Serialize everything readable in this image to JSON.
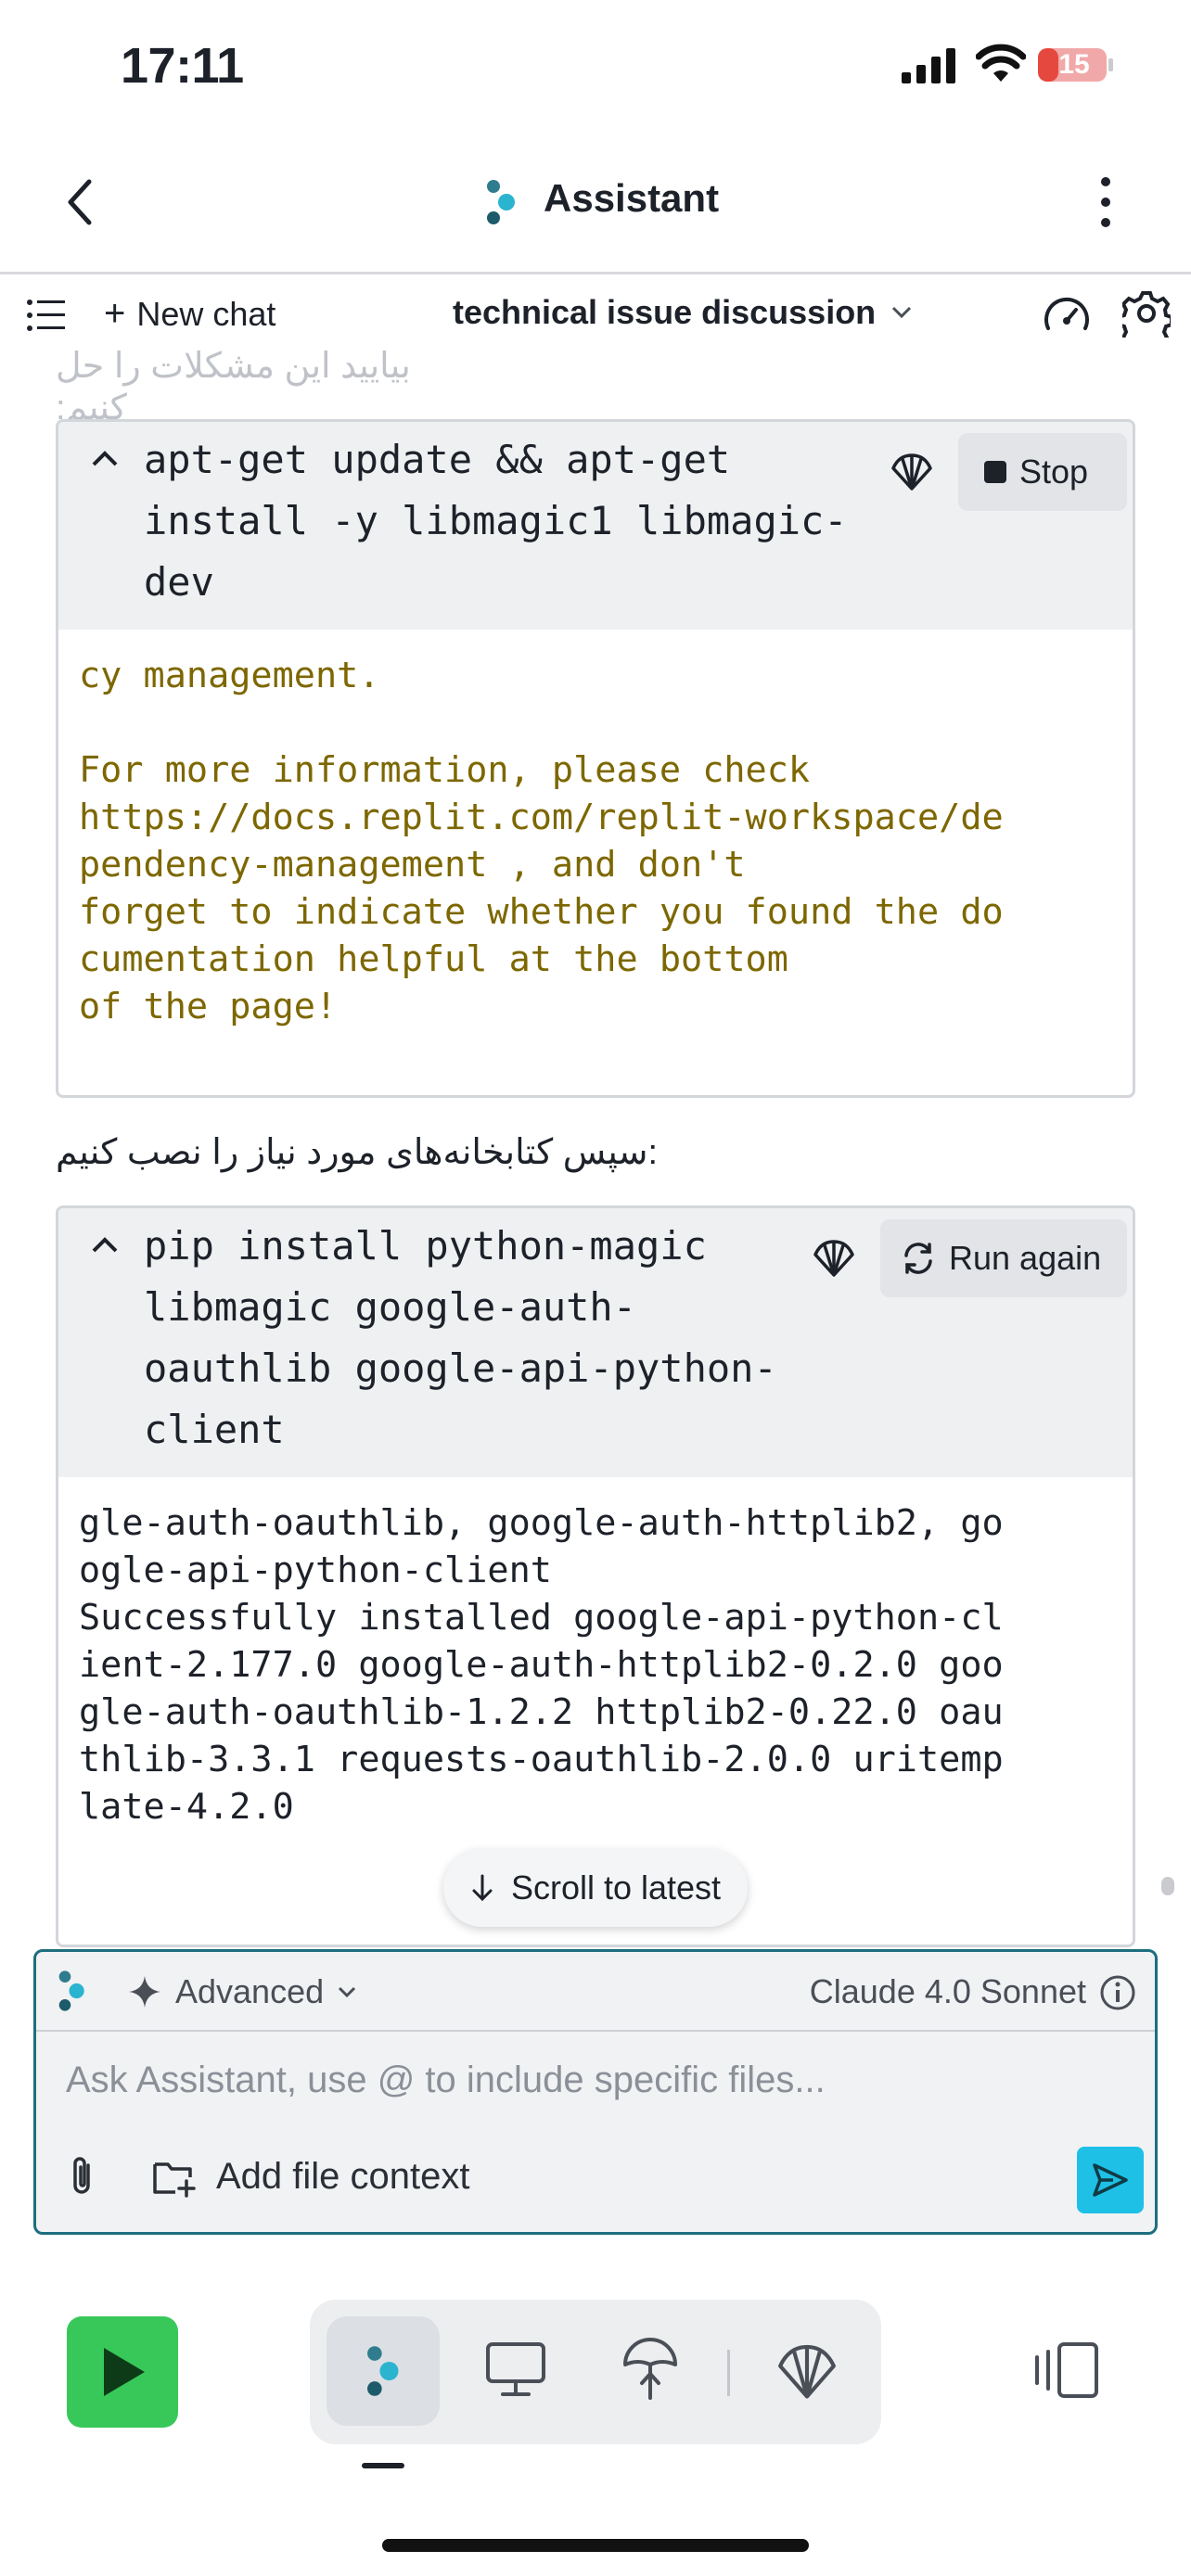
{
  "status_bar": {
    "time": "17:11",
    "battery": "15"
  },
  "header": {
    "title": "Assistant"
  },
  "toolbar": {
    "new_chat": "New chat",
    "topic": "technical issue discussion"
  },
  "chat": {
    "faded_line": "بیایید این مشکلات را حل کنیم:",
    "card1": {
      "command": "apt-get update && apt-get\ninstall -y libmagic1 libmagic-\ndev",
      "button": "Stop",
      "output": "cy management.\n\nFor more information, please check\nhttps://docs.replit.com/replit-workspace/de\npendency-management , and don't\nforget to indicate whether you found the do\ncumentation helpful at the bottom\nof the page!"
    },
    "farsi_line": "سپس کتابخانه‌های مورد نیاز را نصب کنیم:",
    "card2": {
      "command": "pip install python-magic\nlibmagic google-auth-\noauthlib google-api-python-\nclient",
      "button": "Run again",
      "output": "gle-auth-oauthlib, google-auth-httplib2, go\nogle-api-python-client\nSuccessfully installed google-api-python-cl\nient-2.177.0 google-auth-httplib2-0.2.0 goo\ngle-auth-oauthlib-1.2.2 httplib2-0.22.0 oau\nthlib-3.3.1 requests-oauthlib-2.0.0 uritemp\nlate-4.2.0"
    },
    "scroll_latest": "Scroll to latest"
  },
  "composer": {
    "mode": "Advanced",
    "model": "Claude 4.0 Sonnet",
    "placeholder": "Ask Assistant, use @ to include specific files...",
    "add_file_context": "Add file context"
  },
  "colors": {
    "accent": "#1ec0e6",
    "run": "#38c85a",
    "output_olive": "#7d6700",
    "composer_border": "#1e6e7e"
  },
  "icons": [
    "back-icon",
    "assistant-logo-icon",
    "kebab-icon",
    "list-icon",
    "gauge-icon",
    "gear-icon",
    "caret-up-icon",
    "shell-icon",
    "stop-icon",
    "refresh-icon",
    "arrow-down-icon",
    "sparkle-icon",
    "chevron-down-icon",
    "info-icon",
    "paperclip-icon",
    "folder-plus-icon",
    "send-icon",
    "play-icon",
    "monitor-icon",
    "deploy-icon",
    "panel-icon"
  ]
}
